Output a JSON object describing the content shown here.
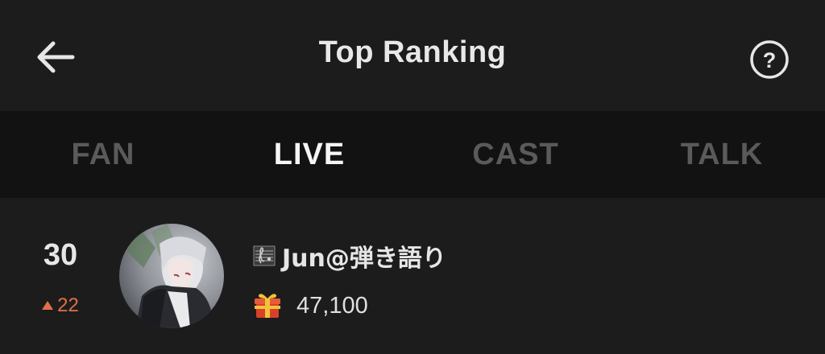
{
  "header": {
    "title": "Top Ranking",
    "back_icon": "arrow-left-icon",
    "help_icon": "question-circle-icon"
  },
  "tabs": [
    {
      "label": "FAN",
      "active": false
    },
    {
      "label": "LIVE",
      "active": true
    },
    {
      "label": "CAST",
      "active": false
    },
    {
      "label": "TALK",
      "active": false
    }
  ],
  "ranking": [
    {
      "rank": "30",
      "change": "22",
      "change_direction": "up",
      "change_color": "#e0704a",
      "name": "Jun@弾き語り",
      "name_icon": "music-score-icon",
      "gift_icon": "gift-box-icon",
      "gift_count": "47,100"
    }
  ],
  "colors": {
    "background": "#1c1c1c",
    "tab_bar": "#121212",
    "tab_active": "#f5f5f5",
    "tab_inactive": "#5a5a5a"
  }
}
